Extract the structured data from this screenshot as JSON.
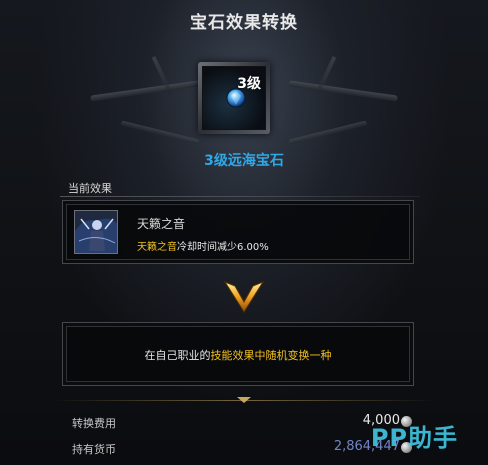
{
  "dialog": {
    "title": "宝石效果转换"
  },
  "gem": {
    "level": "3级",
    "name": "3级远海宝石",
    "icon": "blue-gem-icon",
    "name_color": "#2fa8e8"
  },
  "current_effect": {
    "section_label": "当前效果",
    "skill_icon": "skill-portrait-icon",
    "skill_name": "天籁之音",
    "desc_highlight": "天籁之音",
    "desc_rest": "冷却时间减少6.00%"
  },
  "conversion": {
    "arrow_icon": "gold-down-arrow-icon",
    "text_prefix": "在自己职业的",
    "text_highlight": "技能效果中随机变换一种"
  },
  "currency": {
    "cost_label": "转换费用",
    "cost_value": "4,000",
    "have_label": "持有货币",
    "have_value": "2,864,447",
    "coin_icon": "silver-coin-icon",
    "highlight_color": "#f0c020"
  },
  "watermark": "PP助手"
}
